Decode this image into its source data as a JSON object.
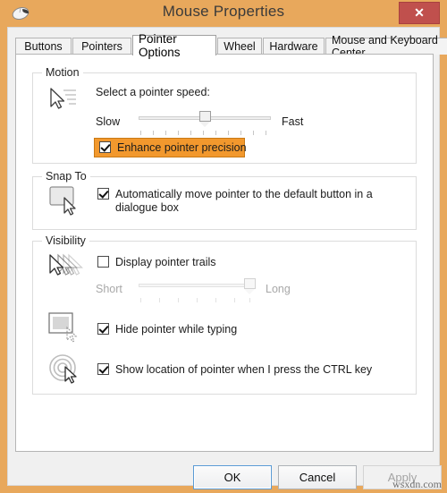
{
  "window": {
    "title": "Mouse Properties",
    "icon": "mouse-icon",
    "close_label": "✕",
    "frame_color": "#e8a85c",
    "close_color": "#c0504d"
  },
  "tabs": [
    {
      "label": "Buttons",
      "active": false
    },
    {
      "label": "Pointers",
      "active": false
    },
    {
      "label": "Pointer Options",
      "active": true
    },
    {
      "label": "Wheel",
      "active": false
    },
    {
      "label": "Hardware",
      "active": false
    },
    {
      "label": "Mouse and Keyboard Center",
      "active": false
    }
  ],
  "motion": {
    "group_title": "Motion",
    "icon": "pointer-speed-icon",
    "speed_label": "Select a pointer speed:",
    "slider": {
      "min_label": "Slow",
      "max_label": "Fast",
      "value_percent": 50,
      "ticks": 11,
      "enabled": true
    },
    "enhance_precision": {
      "label": "Enhance pointer precision",
      "checked": true,
      "highlighted": true,
      "highlight_color": "#f2982d"
    }
  },
  "snap_to": {
    "group_title": "Snap To",
    "icon": "snap-default-button-icon",
    "auto_move": {
      "label": "Automatically move pointer to the default button in a dialogue box",
      "checked": true
    }
  },
  "visibility": {
    "group_title": "Visibility",
    "trails_icon": "pointer-trails-icon",
    "hide_icon": "hide-pointer-typing-icon",
    "locate_icon": "locate-pointer-icon",
    "display_trails": {
      "label": "Display pointer trails",
      "checked": false
    },
    "trails_slider": {
      "min_label": "Short",
      "max_label": "Long",
      "value_percent": 100,
      "ticks": 7,
      "enabled": false
    },
    "hide_while_typing": {
      "label": "Hide pointer while typing",
      "checked": true
    },
    "show_location": {
      "label": "Show location of pointer when I press the CTRL key",
      "checked": true
    }
  },
  "footer": {
    "ok": "OK",
    "cancel": "Cancel",
    "apply": "Apply",
    "apply_disabled": true
  },
  "watermark": "wsxdn.com"
}
